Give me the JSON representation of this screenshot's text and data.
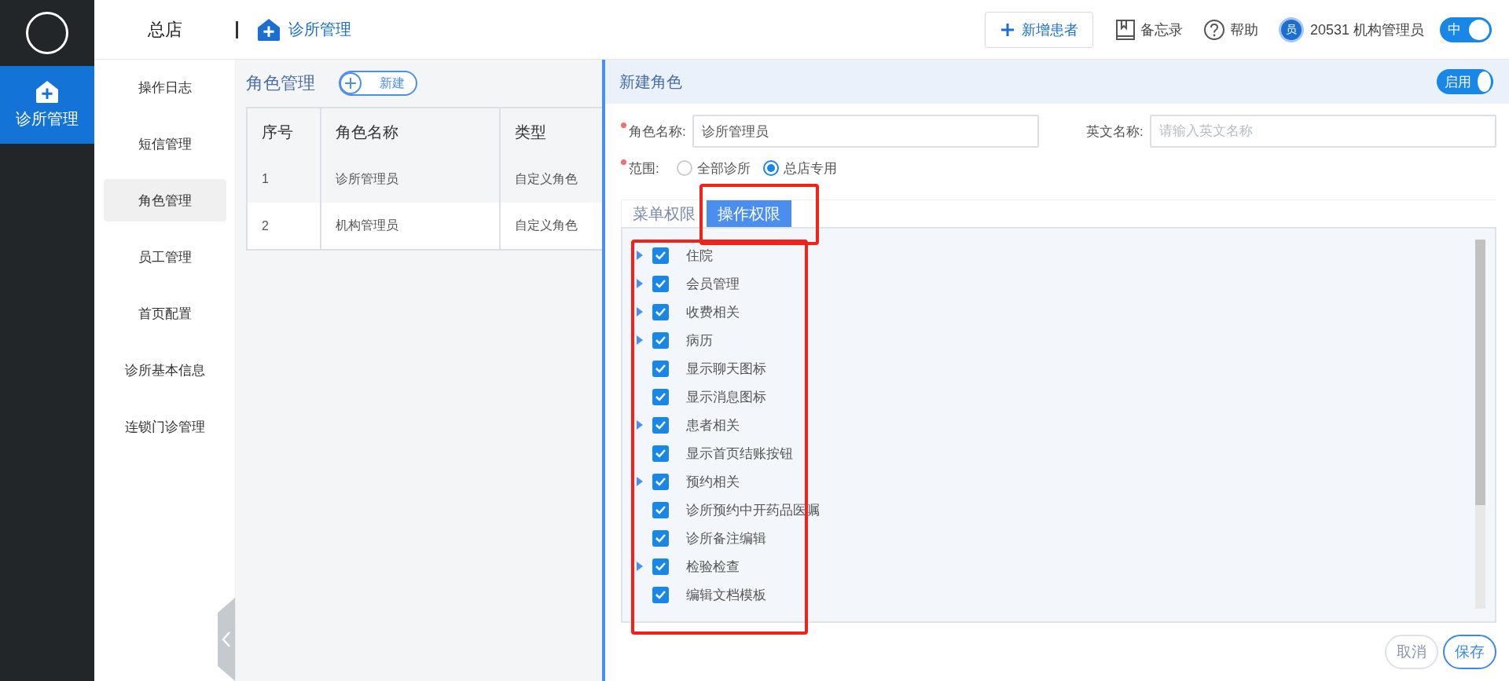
{
  "rail": {
    "items": [
      {
        "label": "诊所管理",
        "selected": true
      }
    ]
  },
  "header": {
    "store": "总店",
    "module": "诊所管理",
    "actions": [
      {
        "kind": "add",
        "label": "新增患者"
      },
      {
        "kind": "memo",
        "label": "备忘录"
      },
      {
        "kind": "help",
        "label": "帮助"
      }
    ],
    "user": {
      "avatar": "员",
      "name": "20531 机构管理员"
    },
    "language_toggle": {
      "label": "中",
      "on": true
    }
  },
  "sidebar": {
    "items": [
      {
        "label": "操作日志",
        "selected": false
      },
      {
        "label": "短信管理",
        "selected": false
      },
      {
        "label": "角色管理",
        "selected": true
      },
      {
        "label": "员工管理",
        "selected": false
      },
      {
        "label": "首页配置",
        "selected": false
      },
      {
        "label": "诊所基本信息",
        "selected": false
      },
      {
        "label": "连锁门诊管理",
        "selected": false
      }
    ]
  },
  "roles": {
    "title": "角色管理",
    "new_button": "新建",
    "table": {
      "columns": [
        "序号",
        "角色名称",
        "类型"
      ],
      "rows": [
        [
          "1",
          "诊所管理员",
          "自定义角色"
        ],
        [
          "2",
          "机构管理员",
          "自定义角色"
        ]
      ]
    }
  },
  "editor": {
    "title": "新建角色",
    "enable_toggle": {
      "label": "启用",
      "on": true
    },
    "fields": [
      {
        "label": "角色名称:",
        "required": true,
        "value": "诊所管理员"
      },
      {
        "label": "英文名称:",
        "required": false,
        "placeholder": "请输入英文名称"
      }
    ],
    "scope": {
      "label": "范围:",
      "required": true,
      "options": [
        {
          "label": "全部诊所",
          "selected": false
        },
        {
          "label": "总店专用",
          "selected": true
        }
      ]
    },
    "tabs": [
      {
        "label": "菜单权限",
        "selected": false
      },
      {
        "label": "操作权限",
        "selected": true
      }
    ],
    "permissions": [
      {
        "label": "住院",
        "checked": true,
        "expandable": true
      },
      {
        "label": "会员管理",
        "checked": true,
        "expandable": true
      },
      {
        "label": "收费相关",
        "checked": true,
        "expandable": true
      },
      {
        "label": "病历",
        "checked": true,
        "expandable": true
      },
      {
        "label": "显示聊天图标",
        "checked": true,
        "expandable": false
      },
      {
        "label": "显示消息图标",
        "checked": true,
        "expandable": false
      },
      {
        "label": "患者相关",
        "checked": true,
        "expandable": true
      },
      {
        "label": "显示首页结账按钮",
        "checked": true,
        "expandable": false
      },
      {
        "label": "预约相关",
        "checked": true,
        "expandable": true
      },
      {
        "label": "诊所预约中开药品医嘱",
        "checked": true,
        "expandable": false
      },
      {
        "label": "诊所备注编辑",
        "checked": true,
        "expandable": false
      },
      {
        "label": "检验检查",
        "checked": true,
        "expandable": true
      },
      {
        "label": "编辑文档模板",
        "checked": true,
        "expandable": false
      }
    ],
    "buttons": [
      {
        "kind": "cancel",
        "label": "取消"
      },
      {
        "kind": "save",
        "label": "保存"
      }
    ]
  },
  "highlights": {
    "selected_tab": true,
    "permission_list": true
  }
}
